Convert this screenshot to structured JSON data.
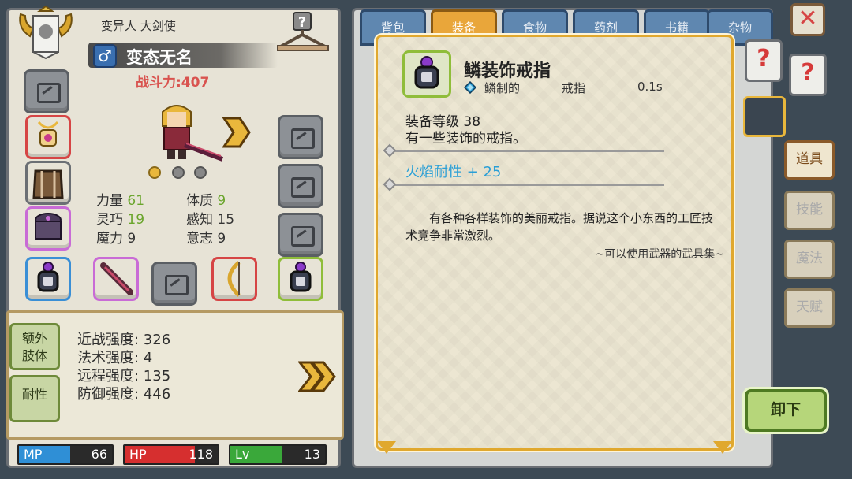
{
  "character": {
    "race_class": "变异人 大剑使",
    "gender_symbol": "♂",
    "name": "变态无名",
    "power": "战斗力:407"
  },
  "attributes": [
    {
      "label": "力量",
      "value": "61",
      "highlight": true
    },
    {
      "label": "体质",
      "value": "9",
      "highlight": true
    },
    {
      "label": "灵巧",
      "value": "19",
      "highlight": true
    },
    {
      "label": "感知",
      "value": "15",
      "highlight": false
    },
    {
      "label": "魔力",
      "value": "9",
      "highlight": false
    },
    {
      "label": "意志",
      "value": "9",
      "highlight": false
    }
  ],
  "side_buttons": {
    "extra_limbs": "额外\n肢体",
    "resistance": "耐性"
  },
  "stats": [
    "近战强度: 326",
    "法术强度: 4",
    "远程强度: 135",
    "防御强度: 446"
  ],
  "bars": {
    "mp": {
      "label": "MP",
      "value": "66",
      "fill": 0.55,
      "color": "#2f8fd6"
    },
    "hp": {
      "label": "HP",
      "value": "118",
      "fill": 0.75,
      "color": "#d62f2f"
    },
    "lv": {
      "label": "Lv",
      "value": "13",
      "fill": 0.55,
      "color": "#3aa83a"
    }
  },
  "top_tabs": [
    {
      "label": "背包",
      "active": false
    },
    {
      "label": "装备",
      "active": true
    },
    {
      "label": "食物",
      "active": false
    },
    {
      "label": "药剂",
      "active": false
    },
    {
      "label": "书籍",
      "active": false
    },
    {
      "label": "杂物",
      "active": false
    }
  ],
  "right_tabs": [
    {
      "label": "道具",
      "active": true
    },
    {
      "label": "技能",
      "active": false
    },
    {
      "label": "魔法",
      "active": false
    },
    {
      "label": "天赋",
      "active": false
    }
  ],
  "close_symbol": "✕",
  "help_symbol": "?",
  "unequip_label": "卸下",
  "item": {
    "name": "鳞装饰戒指",
    "material": "鳞制的",
    "type": "戒指",
    "weight": "0.1s",
    "level": "装备等级 38",
    "short_desc": "有一些装饰的戒指。",
    "bonus": "火焰耐性 + 25",
    "description": "有各种各样装饰的美丽戒指。据说这个小东西的工匠技术竞争非常激烈。",
    "source": "~可以使用武器的武具集~"
  },
  "colors": {
    "accent_gold": "#e0a82e",
    "bonus_blue": "#2a9fd6",
    "power_red": "#d9534f",
    "attr_green": "#6aa52c"
  }
}
